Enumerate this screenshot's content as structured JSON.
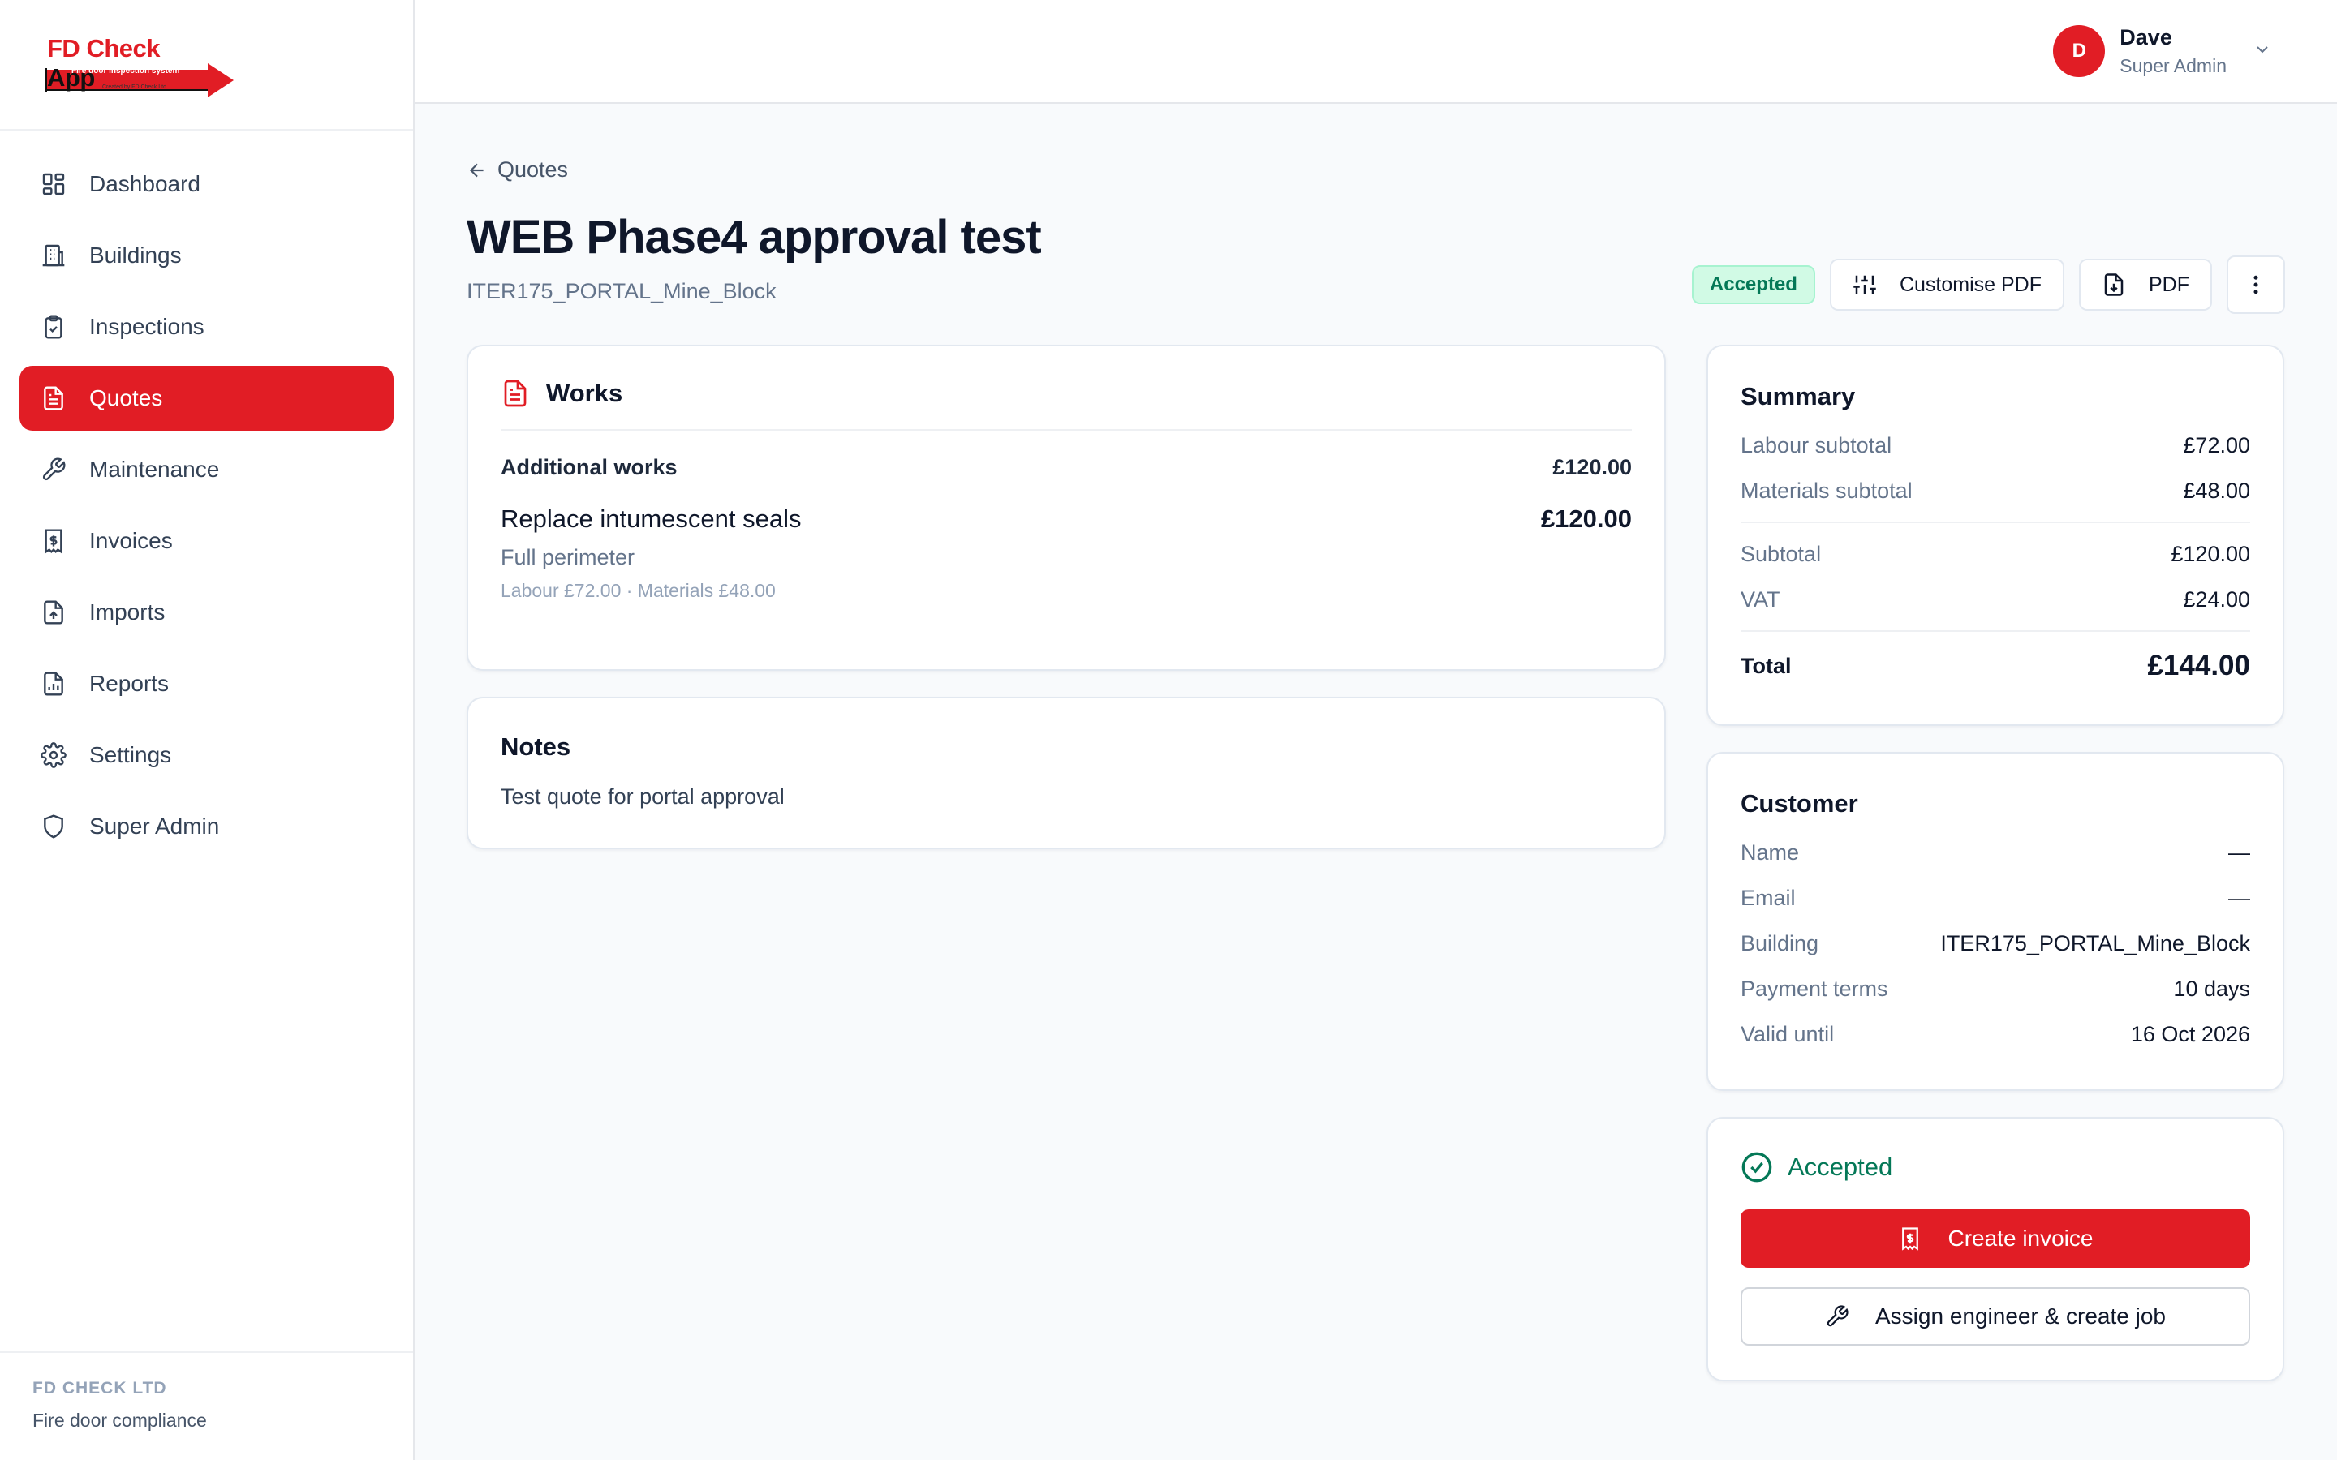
{
  "brand": {
    "logo_fd": "FD",
    "logo_check": "Check",
    "logo_app": "App",
    "logo_subtitle": "Fire door inspection system",
    "logo_credit": "Created by FD Check Ltd",
    "company": "FD CHECK LTD",
    "tagline": "Fire door compliance",
    "accent_color": "#e11d25"
  },
  "sidebar": {
    "items": [
      {
        "label": "Dashboard",
        "icon": "dashboard-icon"
      },
      {
        "label": "Buildings",
        "icon": "building-icon"
      },
      {
        "label": "Inspections",
        "icon": "clipboard-check-icon"
      },
      {
        "label": "Quotes",
        "icon": "document-icon",
        "active": true
      },
      {
        "label": "Maintenance",
        "icon": "wrench-icon"
      },
      {
        "label": "Invoices",
        "icon": "receipt-icon"
      },
      {
        "label": "Imports",
        "icon": "file-upload-icon"
      },
      {
        "label": "Reports",
        "icon": "report-chart-icon"
      },
      {
        "label": "Settings",
        "icon": "gear-icon"
      },
      {
        "label": "Super Admin",
        "icon": "shield-icon"
      }
    ]
  },
  "user": {
    "initial": "D",
    "name": "Dave",
    "role": "Super Admin"
  },
  "page": {
    "back_label": "Quotes",
    "title": "WEB Phase4 approval test",
    "subtitle": "ITER175_PORTAL_Mine_Block",
    "status_badge": "Accepted",
    "customise_pdf_label": "Customise PDF",
    "pdf_label": "PDF"
  },
  "works": {
    "title": "Works",
    "group_title": "Additional works",
    "group_total": "£120.00",
    "item_name": "Replace intumescent seals",
    "item_price": "£120.00",
    "item_desc": "Full perimeter",
    "item_meta": "Labour £72.00 · Materials £48.00"
  },
  "notes": {
    "title": "Notes",
    "text": "Test quote for portal approval"
  },
  "summary": {
    "title": "Summary",
    "labour_label": "Labour subtotal",
    "labour_value": "£72.00",
    "materials_label": "Materials subtotal",
    "materials_value": "£48.00",
    "subtotal_label": "Subtotal",
    "subtotal_value": "£120.00",
    "vat_label": "VAT",
    "vat_value": "£24.00",
    "total_label": "Total",
    "total_value": "£144.00"
  },
  "customer": {
    "title": "Customer",
    "name_label": "Name",
    "name_value": "—",
    "email_label": "Email",
    "email_value": "—",
    "building_label": "Building",
    "building_value": "ITER175_PORTAL_Mine_Block",
    "terms_label": "Payment terms",
    "terms_value": "10 days",
    "valid_label": "Valid until",
    "valid_value": "16 Oct 2026"
  },
  "status": {
    "label": "Accepted",
    "create_invoice_label": "Create invoice",
    "assign_label": "Assign engineer & create job"
  }
}
